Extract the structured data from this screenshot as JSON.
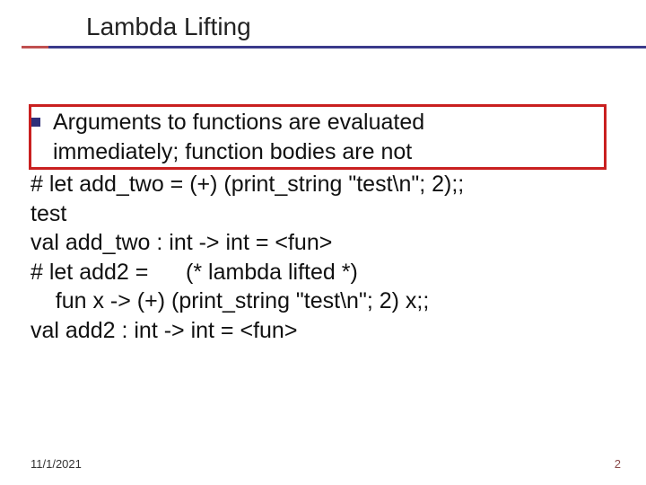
{
  "title": "Lambda Lifting",
  "bullet": {
    "line1": "Arguments to functions are evaluated",
    "line2": "immediately; function bodies are not"
  },
  "code": {
    "l1": "# let add_two = (+) (print_string \"test\\n\"; 2);;",
    "l2": "test",
    "l3": "val add_two : int -> int = <fun>",
    "l4": "# let add2 =      (* lambda lifted *)",
    "l5": "    fun x -> (+) (print_string \"test\\n\"; 2) x;;",
    "l6": "val add2 : int -> int = <fun>"
  },
  "footer": {
    "date": "11/1/2021",
    "page": "2"
  }
}
